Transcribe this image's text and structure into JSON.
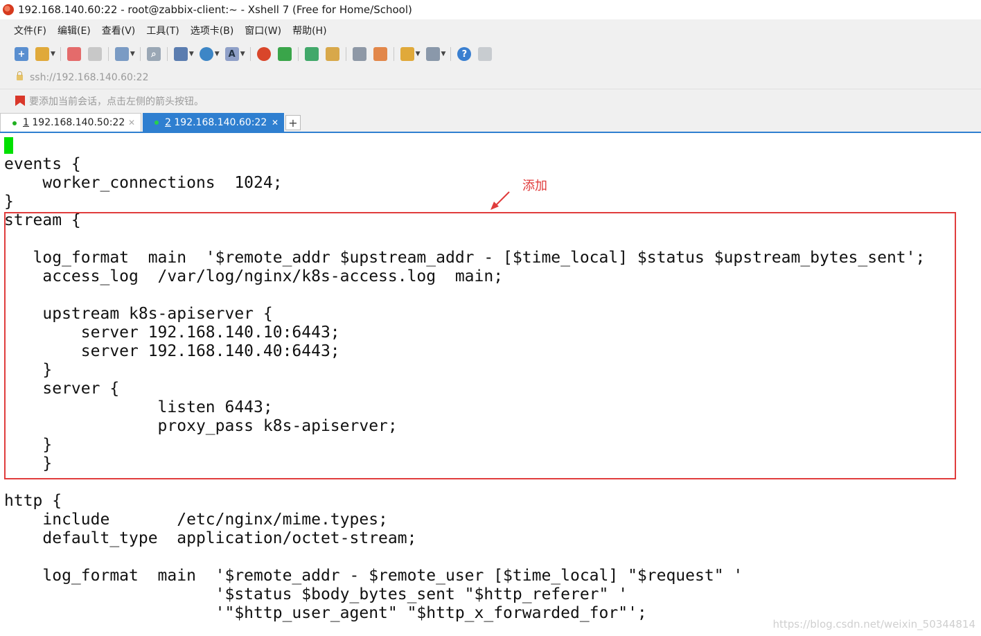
{
  "window": {
    "title": "192.168.140.60:22 - root@zabbix-client:~ - Xshell 7 (Free for Home/School)"
  },
  "menu": [
    "文件(F)",
    "编辑(E)",
    "查看(V)",
    "工具(T)",
    "选项卡(B)",
    "窗口(W)",
    "帮助(H)"
  ],
  "address": {
    "url": "ssh://192.168.140.60:22"
  },
  "hint": {
    "text": "要添加当前会话，点击左侧的箭头按钮。"
  },
  "tabs": [
    {
      "num": "1",
      "label": "192.168.140.50:22",
      "active": false
    },
    {
      "num": "2",
      "label": "192.168.140.60:22",
      "active": true
    }
  ],
  "terminal": {
    "lines": [
      "events {",
      "    worker_connections  1024;",
      "}",
      "stream {",
      "",
      "   log_format  main  '$remote_addr $upstream_addr - [$time_local] $status $upstream_bytes_sent';",
      "    access_log  /var/log/nginx/k8s-access.log  main;",
      "",
      "    upstream k8s-apiserver {",
      "        server 192.168.140.10:6443;",
      "        server 192.168.140.40:6443;",
      "    }",
      "    server {",
      "                listen 6443;",
      "                proxy_pass k8s-apiserver;",
      "    }",
      "    }",
      "",
      "http {",
      "    include       /etc/nginx/mime.types;",
      "    default_type  application/octet-stream;",
      "",
      "    log_format  main  '$remote_addr - $remote_user [$time_local] \"$request\" '",
      "                      '$status $body_bytes_sent \"$http_referer\" '",
      "                      '\"$http_user_agent\" \"$http_x_forwarded_for\"';"
    ]
  },
  "annotation": {
    "text": "添加",
    "color": "#e03c3c"
  },
  "watermark": {
    "text": "https://blog.csdn.net/weixin_50344814"
  },
  "colors": {
    "accent": "#2f7fd0",
    "cursor": "#00e000",
    "annotation": "#e03c3c"
  }
}
